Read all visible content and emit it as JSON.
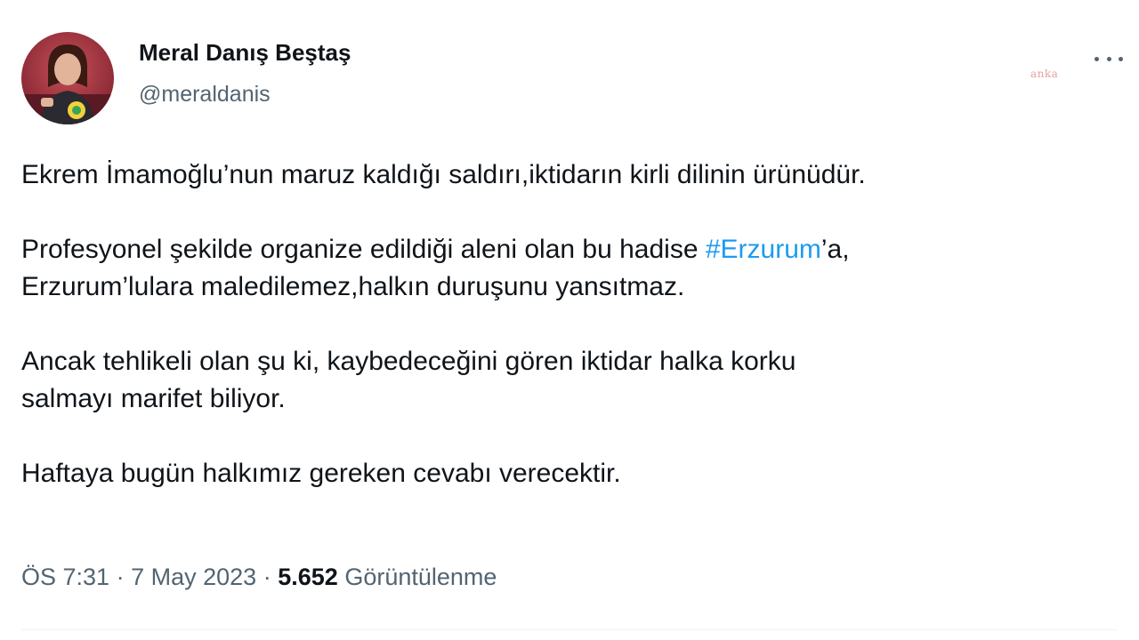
{
  "author": {
    "name": "Meral Danış Beştaş",
    "handle": "@meraldanis"
  },
  "watermark": "anka",
  "more_icon": "more-horizontal-icon",
  "body": {
    "p1": "Ekrem İmamoğlu’nun maruz kaldığı saldırı,iktidarın kirli dilinin ürünüdür.",
    "p2_before": "Profesyonel şekilde organize edildiği aleni olan bu hadise ",
    "p2_hashtag": "#Erzurum",
    "p2_after": "’a,",
    "p2_line2": "Erzurum’lulara maledilemez,halkın duruşunu yansıtmaz.",
    "p3_line1": "Ancak tehlikeli olan şu ki, kaybedeceğini gören iktidar halka korku",
    "p3_line2": "salmayı marifet biliyor.",
    "p4": "Haftaya bugün halkımız gereken cevabı verecektir."
  },
  "meta": {
    "time": "ÖS 7:31",
    "separator": "·",
    "date": "7 May 2023",
    "views_count": "5.652",
    "views_label": "Görüntülenme"
  },
  "colors": {
    "text": "#0f1419",
    "secondary": "#536471",
    "link": "#1d9bf0"
  }
}
